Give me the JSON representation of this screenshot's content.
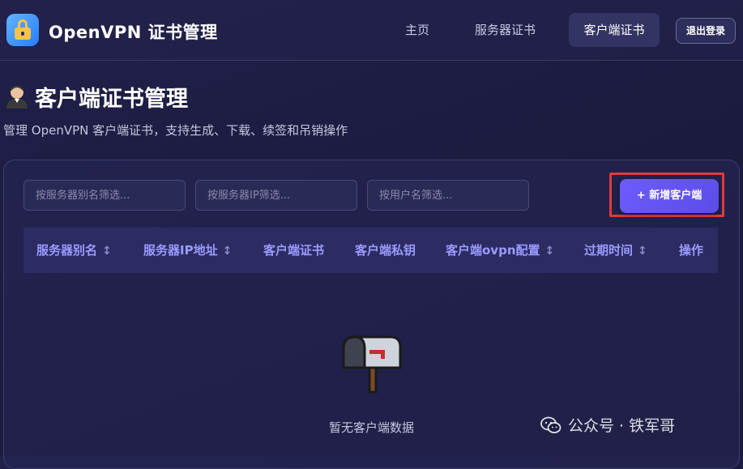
{
  "header": {
    "app_title": "OpenVPN 证书管理",
    "nav": {
      "home": "主页",
      "server_certs": "服务器证书",
      "client_certs": "客户端证书"
    },
    "logout": "退出登录",
    "active_nav": "client_certs"
  },
  "page": {
    "title": "客户端证书管理",
    "subtitle": "管理 OpenVPN 客户端证书，支持生成、下载、续签和吊销操作"
  },
  "filters": {
    "server_alias_placeholder": "按服务器别名筛选...",
    "server_ip_placeholder": "按服务器IP筛选...",
    "username_placeholder": "按用户名筛选..."
  },
  "add_button": "+ 新增客户端",
  "table": {
    "columns": [
      {
        "label": "服务器别名",
        "sortable": true
      },
      {
        "label": "服务器IP地址",
        "sortable": true
      },
      {
        "label": "客户端证书",
        "sortable": false
      },
      {
        "label": "客户端私钥",
        "sortable": false
      },
      {
        "label": "客户端ovpn配置",
        "sortable": true
      },
      {
        "label": "过期时间",
        "sortable": true
      },
      {
        "label": "操作",
        "sortable": false
      }
    ],
    "sort_glyph": "↕",
    "rows": []
  },
  "empty_state": {
    "icon": "mailbox-icon",
    "text": "暂无客户端数据"
  },
  "watermark": {
    "text": "公众号 · 铁军哥",
    "icon": "wechat-icon"
  },
  "colors": {
    "accent": "#6e5cff",
    "header_text": "#9a9bff",
    "highlight": "#e23a3a"
  }
}
